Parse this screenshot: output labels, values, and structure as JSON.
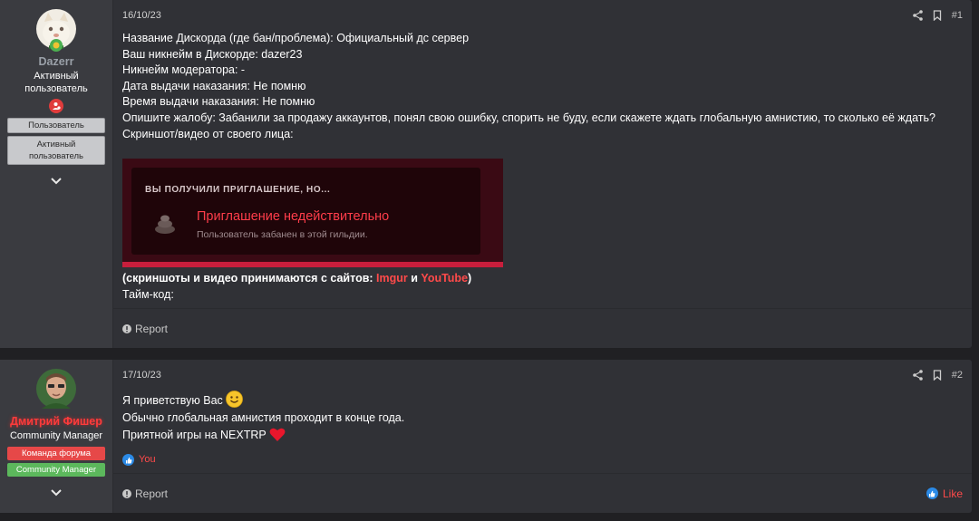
{
  "posts": [
    {
      "user": {
        "name": "Dazerr",
        "title": "Активный пользователь",
        "badges": [
          "Пользователь",
          "Активный пользователь"
        ]
      },
      "date": "16/10/23",
      "number": "#1",
      "lines": [
        "Название Дискорда (где бан/проблема): Официальный дс сервер",
        "Ваш никнейм в Дискорде: dazer23",
        "Никнейм модератора: -",
        "Дата выдачи наказания: Не помню",
        "Время выдачи наказания: Не помню",
        "Опишите жалобу: Забанили за продажу аккаунтов, понял свою ошибку, спорить не буду, если скажете ждать глобальную амнистию, то сколько её ждать?",
        "Скриншот/видео от своего лица:"
      ],
      "screenshot": {
        "title": "ВЫ ПОЛУЧИЛИ ПРИГЛАШЕНИЕ, НО...",
        "error": "Приглашение недействительно",
        "sub": "Пользователь забанен в этой гильдии."
      },
      "sources": {
        "prefix": "(скриншоты и видео принимаются с сайтов: ",
        "imgur": "Imgur",
        "and": " и ",
        "youtube": "YouTube",
        "suffix": ")"
      },
      "timecode": "Тайм-код:",
      "report": "Report"
    },
    {
      "user": {
        "name": "Дмитрий Фишер",
        "title": "Community Manager",
        "badges": [
          "Команда форума",
          "Community Manager"
        ]
      },
      "date": "17/10/23",
      "number": "#2",
      "lines": [
        "Я приветствую Вас",
        "Обычно глобальная амнистия проходит в конце года.",
        "Приятной игры на NEXTRP"
      ],
      "reactions": "You",
      "report": "Report",
      "like": "Like"
    }
  ],
  "colors": {
    "accent": "#ff4a4a",
    "badge_red": "#e64848",
    "badge_green": "#5cb85c",
    "like_blue": "#2b8ae6"
  }
}
